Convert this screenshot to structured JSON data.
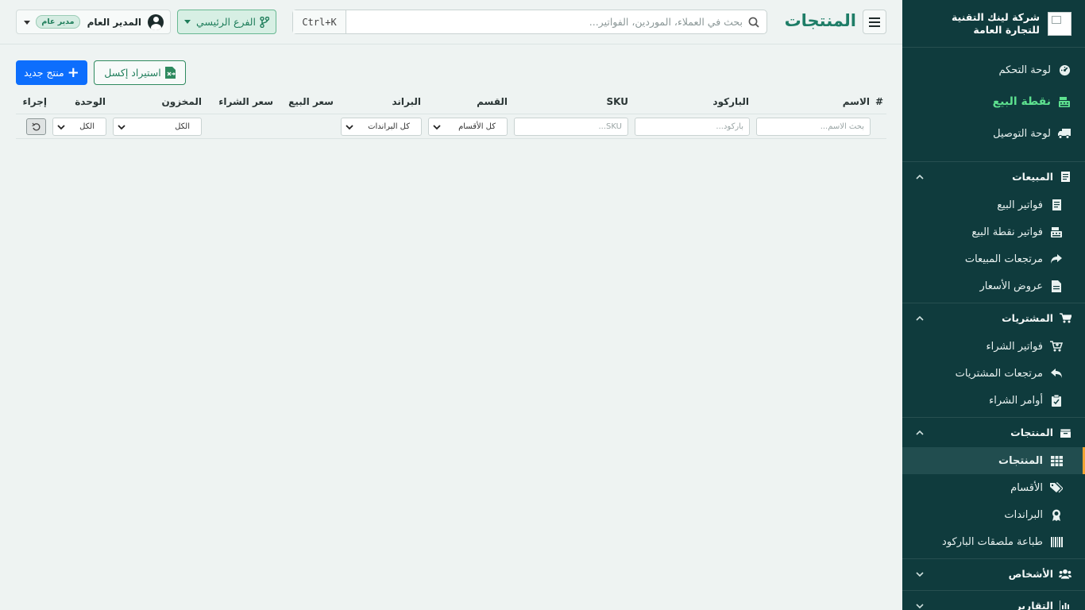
{
  "sidebar": {
    "brand": "شركة لينك التقنية للتجارة العامة",
    "top_items": [
      {
        "label": "لوحة التحكم",
        "icon": "dashboard-icon"
      },
      {
        "label": "نقطة البيع",
        "icon": "cash-register-icon"
      },
      {
        "label": "لوحة التوصيل",
        "icon": "truck-icon"
      }
    ],
    "groups": [
      {
        "label": "المبيعات",
        "icon": "receipt-icon",
        "expanded": true,
        "items": [
          {
            "label": "فواتير البيع",
            "icon": "receipt-icon"
          },
          {
            "label": "فواتير نقطة البيع",
            "icon": "cash-register-icon"
          },
          {
            "label": "مرتجعات المبيعات",
            "icon": "share-icon"
          },
          {
            "label": "عروض الأسعار",
            "icon": "document-icon"
          }
        ]
      },
      {
        "label": "المشتريات",
        "icon": "cart-icon",
        "expanded": true,
        "items": [
          {
            "label": "فواتير الشراء",
            "icon": "cart-plus-icon"
          },
          {
            "label": "مرتجعات المشتريات",
            "icon": "reply-icon"
          },
          {
            "label": "أوامر الشراء",
            "icon": "clipboard-check-icon"
          }
        ]
      },
      {
        "label": "المنتجات",
        "icon": "box-icon",
        "expanded": true,
        "items": [
          {
            "label": "المنتجات",
            "icon": "table-icon",
            "active": true
          },
          {
            "label": "الأقسام",
            "icon": "tags-icon"
          },
          {
            "label": "البراندات",
            "icon": "award-icon"
          },
          {
            "label": "طباعة ملصقات الباركود",
            "icon": "barcode-icon"
          }
        ]
      },
      {
        "label": "الأشخاص",
        "icon": "users-icon",
        "expanded": false
      },
      {
        "label": "التقارير",
        "icon": "chart-icon",
        "expanded": false
      }
    ]
  },
  "header": {
    "title": "المنتجات",
    "search_placeholder": "بحث في العملاء، الموردين، الفواتير...",
    "search_shortcut": "Ctrl+K",
    "branch_label": "الفرع الرئيسي",
    "user_name": "المدير العام",
    "user_role": "مدير عام"
  },
  "actions": {
    "new_product": "منتج جديد",
    "import_excel": "استيراد إكسل"
  },
  "table": {
    "columns": {
      "index": "#",
      "name": "الاسم",
      "barcode": "الباركود",
      "sku": "SKU",
      "category": "القسم",
      "brand": "البراند",
      "sell_price": "سعر البيع",
      "buy_price": "سعر الشراء",
      "stock": "المخزون",
      "unit": "الوحدة",
      "action": "إجراء"
    },
    "filters": {
      "name_placeholder": "بحث الاسم...",
      "barcode_placeholder": "باركود...",
      "sku_placeholder": "SKU...",
      "category_value": "كل الأقسام",
      "brand_value": "كل البراندات",
      "stock_value": "الكل",
      "unit_value": "الكل"
    }
  },
  "colors": {
    "sidebar_bg": "#0f3b3d",
    "accent_green": "#1e7d67",
    "pos_green": "#5de08f",
    "primary_blue": "#0d6efd",
    "active_marker": "#f0a433"
  }
}
